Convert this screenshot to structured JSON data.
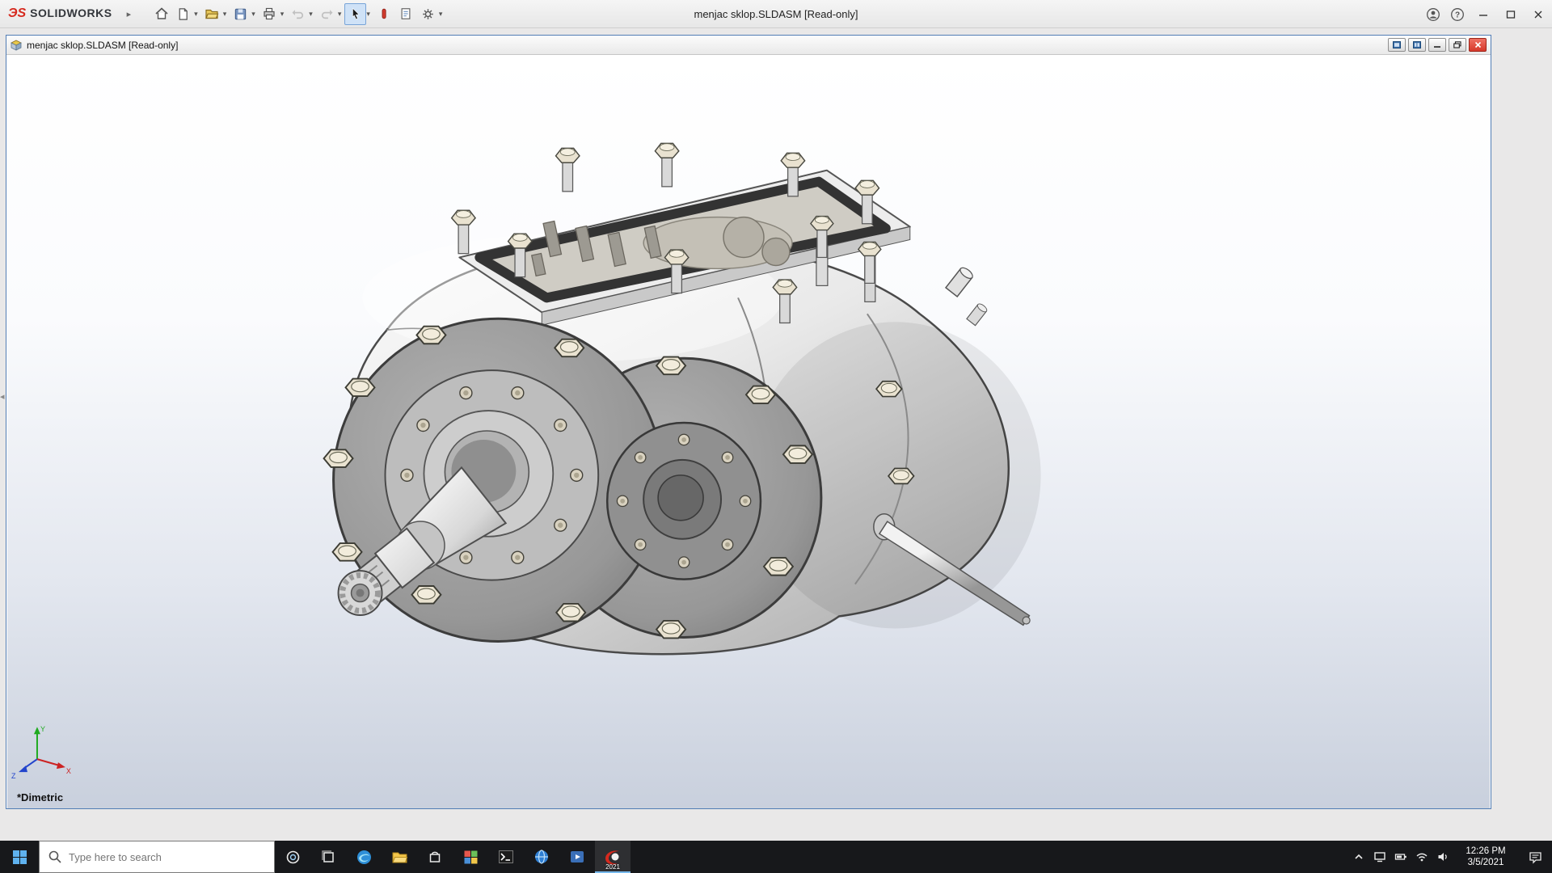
{
  "titlebar": {
    "brand": "SOLIDWORKS",
    "title": "menjac sklop.SLDASM [Read-only]"
  },
  "document": {
    "title": "menjac sklop.SLDASM [Read-only]",
    "view_label": "*Dimetric",
    "axes": {
      "x": "X",
      "y": "Y",
      "z": "Z"
    }
  },
  "taskbar": {
    "search_placeholder": "Type here to search",
    "app_badge_year": "2021",
    "clock_time": "12:26 PM",
    "clock_date": "3/5/2021"
  },
  "colors": {
    "brand_red": "#d6291e",
    "doc_border_blue": "#527db5",
    "taskbar_dark": "#17181b",
    "viewport_bottom": "#c9d0dd"
  }
}
